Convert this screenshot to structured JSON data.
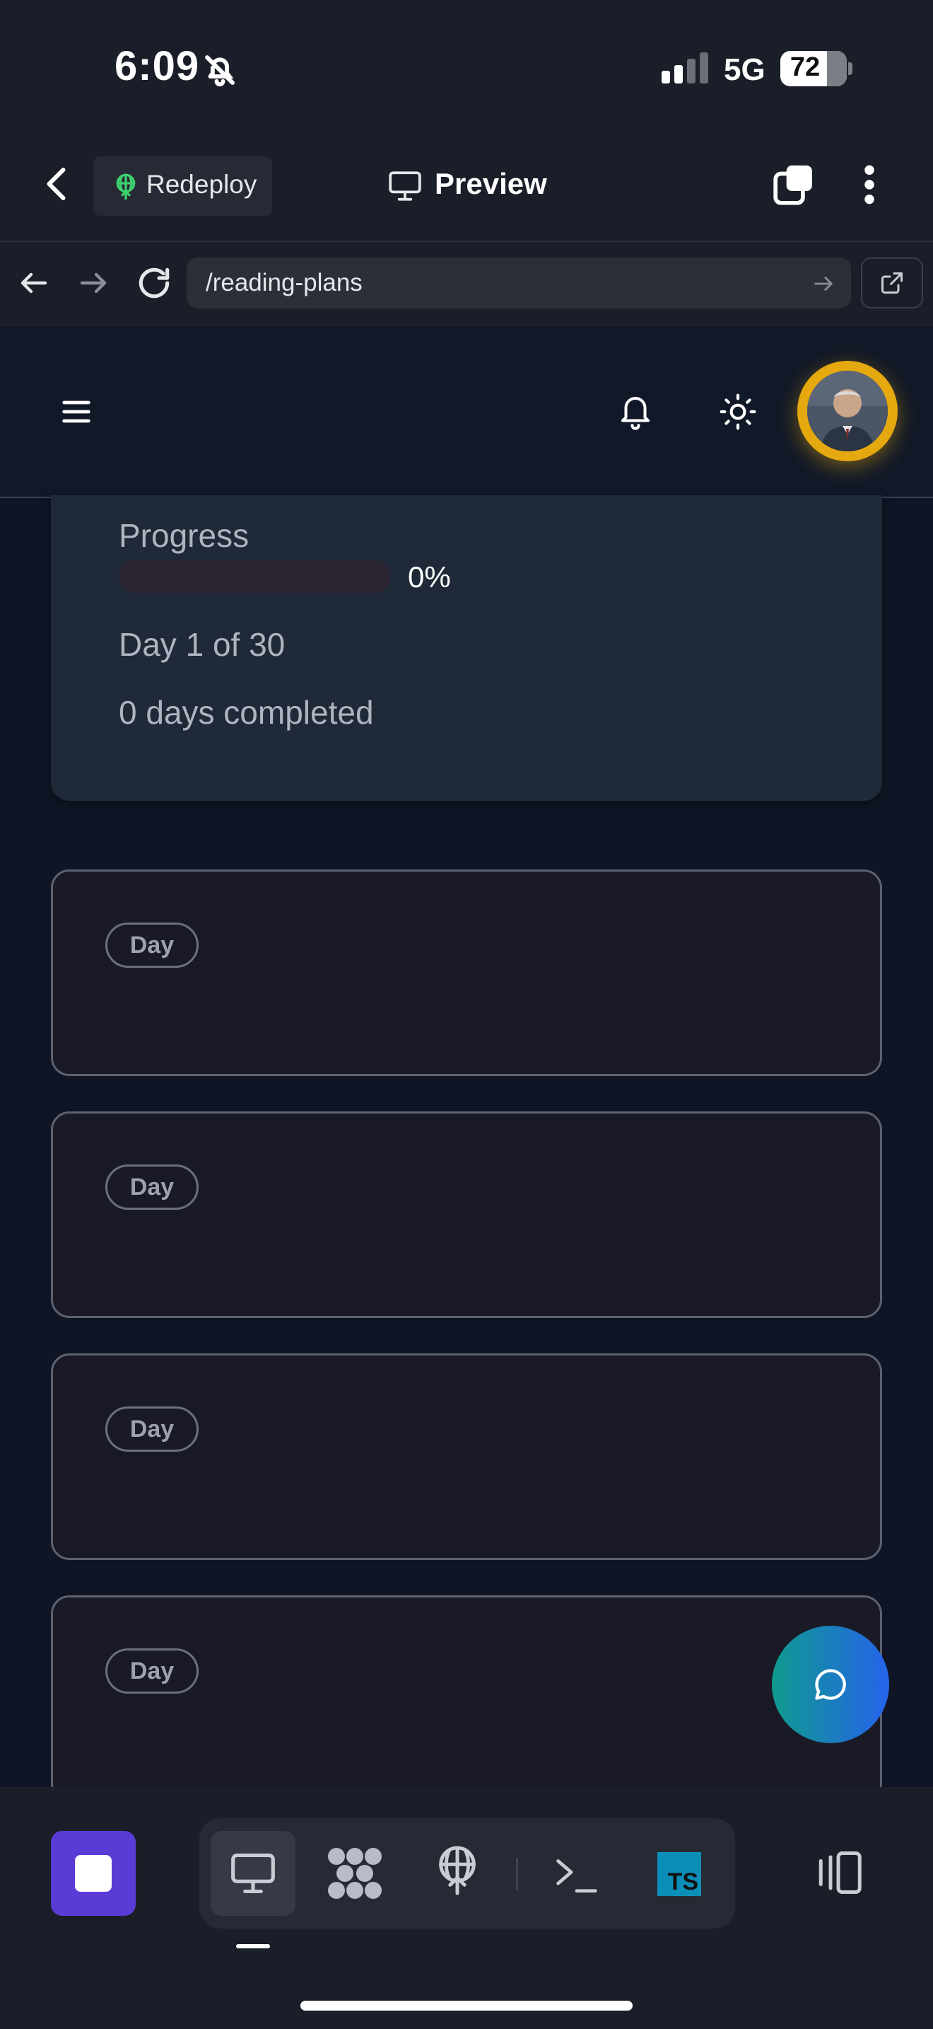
{
  "status_bar": {
    "time": "6:09",
    "network": "5G",
    "battery": "72",
    "icons": [
      "bell-slash-icon",
      "signal-icon",
      "battery-icon"
    ]
  },
  "app_header": {
    "back_icon": "chevron-left-icon",
    "deploy_label": "Redeploy",
    "deploy_icon": "deploy-icon",
    "title": "Preview",
    "title_icon": "monitor-icon",
    "tabs_icon": "tabs-icon",
    "more_icon": "more-vertical-icon"
  },
  "browser": {
    "url": "/reading-plans",
    "icons": [
      "arrow-left-icon",
      "arrow-right-icon",
      "reload-icon",
      "arrow-right-small-icon",
      "external-link-icon"
    ]
  },
  "page_nav": {
    "icons": [
      "menu-icon",
      "bell-icon",
      "sun-icon",
      "avatar"
    ],
    "avatar_ring_color": "#e5a90f"
  },
  "progress": {
    "label": "Progress",
    "percent": "0%",
    "progress_fraction": 0,
    "day_of": "Day 1 of 30",
    "days_completed": "0 days completed"
  },
  "day_cards": [
    {
      "badge": "Day"
    },
    {
      "badge": "Day"
    },
    {
      "badge": "Day"
    },
    {
      "badge": "Day"
    }
  ],
  "fab": {
    "icon": "chat-icon",
    "colors": [
      "#0f9a8e",
      "#2563eb"
    ]
  },
  "dock": {
    "items": [
      "stop-icon",
      "desktop-icon",
      "workspace-dots-icon",
      "deploy-icon",
      "terminal-icon",
      "typescript-icon",
      "panel-toggle-icon"
    ],
    "ts_label": "TS",
    "accent": "#5b3bd6"
  }
}
